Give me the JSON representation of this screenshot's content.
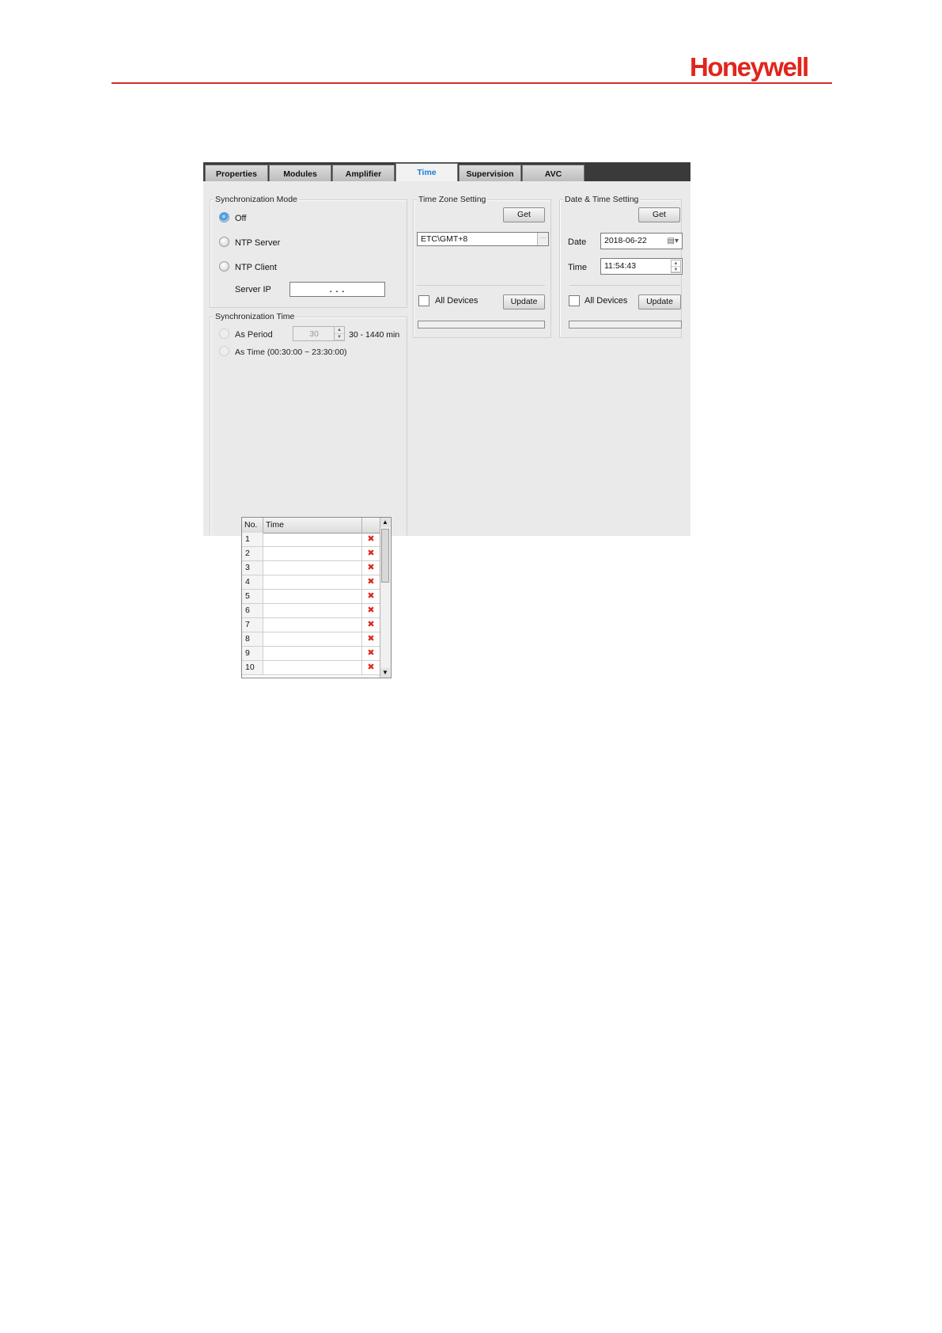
{
  "brand": {
    "logo_text": "Honeywell",
    "accent_color": "#e1251b"
  },
  "tabs": [
    {
      "label": "Properties",
      "active": false
    },
    {
      "label": "Modules",
      "active": false
    },
    {
      "label": "Amplifier",
      "active": false
    },
    {
      "label": "Time",
      "active": true
    },
    {
      "label": "Supervision",
      "active": false
    },
    {
      "label": "AVC",
      "active": false
    }
  ],
  "sync_mode": {
    "legend": "Synchronization Mode",
    "options": [
      {
        "label": "Off",
        "checked": true
      },
      {
        "label": "NTP Server",
        "checked": false
      },
      {
        "label": "NTP Client",
        "checked": false
      }
    ],
    "server_ip_label": "Server IP",
    "server_ip_value": ".      .      ."
  },
  "sync_time": {
    "legend": "Synchronization Time",
    "as_period_label": "As Period",
    "period_value": "30",
    "period_range": "30 - 1440 min",
    "as_time_label": "As Time (00:30:00 ~ 23:30:00)",
    "table": {
      "headers": [
        "No.",
        "Time"
      ],
      "rows": [
        "1",
        "2",
        "3",
        "4",
        "5",
        "6",
        "7",
        "8",
        "9",
        "10"
      ],
      "delete_icon": "✖"
    }
  },
  "timezone": {
    "legend": "Time Zone Setting",
    "get_label": "Get",
    "value": "ETC\\GMT+8",
    "all_devices_label": "All Devices",
    "update_label": "Update"
  },
  "datetime": {
    "legend": "Date & Time Setting",
    "get_label": "Get",
    "date_label": "Date",
    "date_value": "2018-06-22",
    "time_label": "Time",
    "time_value": "11:54:43",
    "all_devices_label": "All Devices",
    "update_label": "Update"
  }
}
